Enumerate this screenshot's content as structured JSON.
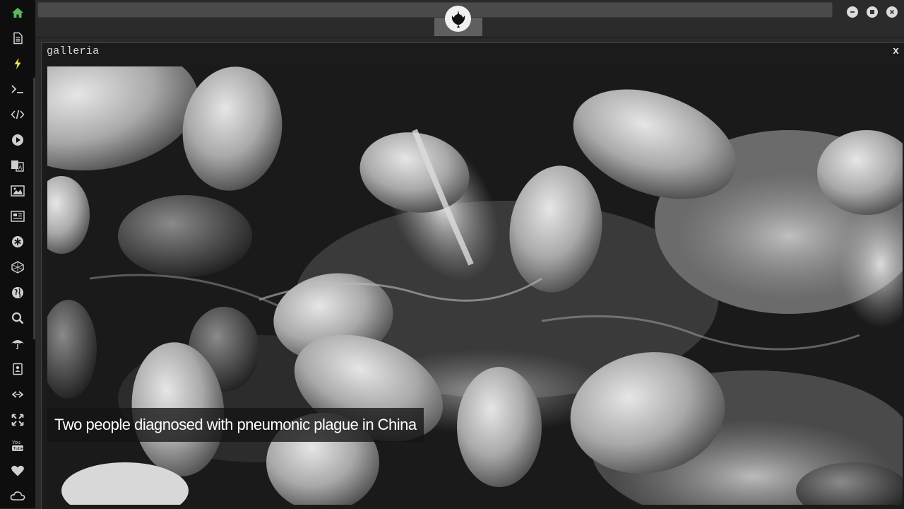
{
  "sidebar": {
    "items": [
      {
        "icon": "home-icon",
        "active_color": "#5cb85c"
      },
      {
        "icon": "document-icon"
      },
      {
        "icon": "lightning-icon",
        "active_color": "#f0e060"
      },
      {
        "icon": "terminal-icon"
      },
      {
        "icon": "code-icon"
      },
      {
        "icon": "play-icon"
      },
      {
        "icon": "translate-icon"
      },
      {
        "icon": "image-icon"
      },
      {
        "icon": "newspaper-icon"
      },
      {
        "icon": "asterisk-icon"
      },
      {
        "icon": "hexagon-icon"
      },
      {
        "icon": "globe-icon"
      },
      {
        "icon": "search-icon"
      },
      {
        "icon": "umbrella-icon"
      },
      {
        "icon": "contact-book-icon"
      },
      {
        "icon": "link-icon"
      },
      {
        "icon": "expand-icon"
      },
      {
        "icon": "youtube-icon"
      },
      {
        "icon": "heart-icon"
      },
      {
        "icon": "cloud-icon"
      }
    ]
  },
  "topbar": {
    "logo": "rebel-alliance-logo"
  },
  "panel": {
    "title": "galleria",
    "close_label": "x"
  },
  "gallery": {
    "caption": "Two people diagnosed with pneumonic plague in China"
  }
}
